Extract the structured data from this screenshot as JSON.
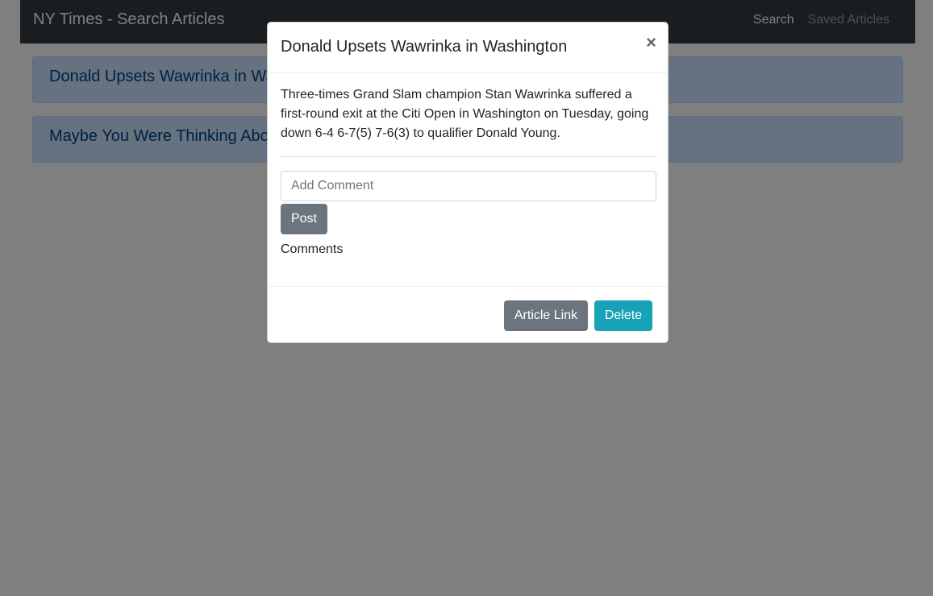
{
  "navbar": {
    "brand": "NY Times - Search Articles",
    "links": [
      {
        "label": "Search",
        "state": "active"
      },
      {
        "label": "Saved Articles",
        "state": "muted"
      }
    ]
  },
  "articles": [
    {
      "title": "Donald Upsets Wawrinka in Washington"
    },
    {
      "title": "Maybe You Were Thinking About Something Else"
    }
  ],
  "modal": {
    "title": "Donald Upsets Wawrinka in Washington",
    "close_symbol": "×",
    "summary": "Three-times Grand Slam champion Stan Wawrinka suffered a first-round exit at the Citi Open in Washington on Tuesday, going down 6-4 6-7(5) 7-6(3) to qualifier Donald Young.",
    "comment_placeholder": "Add Comment",
    "comment_value": "",
    "post_label": "Post",
    "comments_heading": "Comments",
    "article_link_label": "Article Link",
    "delete_label": "Delete"
  },
  "colors": {
    "navbar_bg": "#343a40",
    "card_bg": "#cce5ff",
    "card_text": "#004085",
    "secondary": "#6c757d",
    "info": "#17a2b8"
  }
}
